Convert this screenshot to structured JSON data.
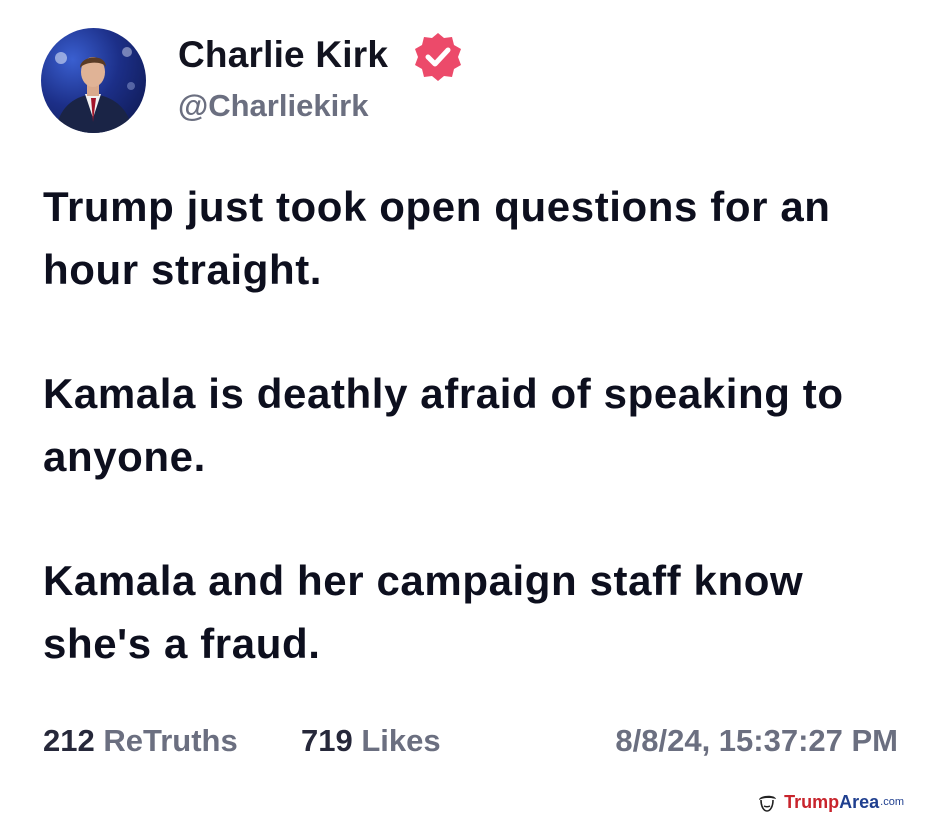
{
  "post": {
    "author": {
      "display_name": "Charlie Kirk",
      "handle": "@Charliekirk",
      "verified_icon": "verified-badge-icon",
      "verified_color": "#ec4a6a"
    },
    "paragraphs": [
      "Trump just took open questions for an hour straight.",
      "Kamala is deathly afraid of speaking to anyone.",
      "Kamala and her campaign staff know she's a fraud."
    ],
    "stats": {
      "retruths_count": "212",
      "retruths_label": "ReTruths",
      "likes_count": "719",
      "likes_label": "Likes",
      "timestamp": "8/8/24, 15:37:27 PM"
    }
  },
  "watermark": {
    "brand_part1": "Trump",
    "brand_part2": "Area",
    "brand_suffix": ".com",
    "icon": "trump-face-icon"
  }
}
